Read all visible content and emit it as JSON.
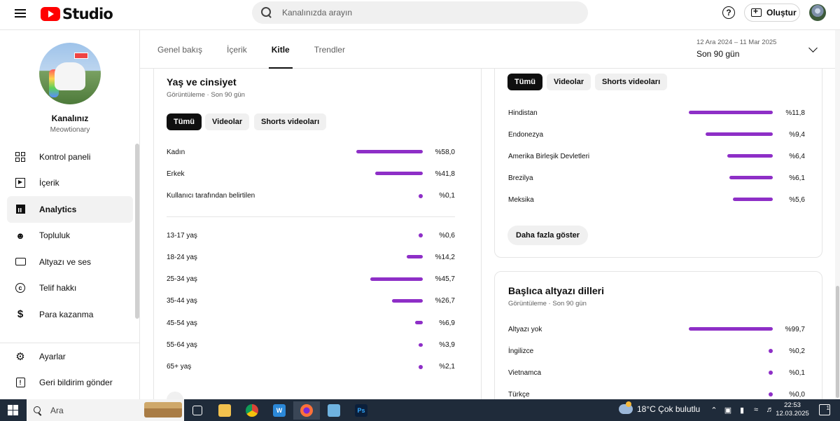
{
  "topbar": {
    "logo_text": "Studio",
    "search_placeholder": "Kanalınızda arayın",
    "create_label": "Oluştur"
  },
  "sidebar": {
    "channel_name": "Kanalınız",
    "channel_handle": "Meowtionary",
    "items": [
      {
        "label": "Kontrol paneli",
        "icon": "dashboard-icon"
      },
      {
        "label": "İçerik",
        "icon": "content-icon"
      },
      {
        "label": "Analytics",
        "icon": "analytics-icon",
        "active": true
      },
      {
        "label": "Topluluk",
        "icon": "community-icon"
      },
      {
        "label": "Altyazı ve ses",
        "icon": "subtitles-icon"
      },
      {
        "label": "Telif hakkı",
        "icon": "copyright-icon"
      },
      {
        "label": "Para kazanma",
        "icon": "dollar-icon"
      }
    ],
    "bottom_items": [
      {
        "label": "Ayarlar",
        "icon": "gear-icon"
      },
      {
        "label": "Geri bildirim gönder",
        "icon": "feedback-icon"
      }
    ]
  },
  "header": {
    "tabs": [
      "Genel bakış",
      "İçerik",
      "Kitle",
      "Trendler"
    ],
    "active_tab": "Kitle",
    "date_range": "12 Ara 2024 – 11 Mar 2025",
    "period": "Son 90 gün"
  },
  "age_gender": {
    "title": "Yaş ve cinsiyet",
    "subtitle": "Görüntüleme · Son 90 gün",
    "chips": [
      "Tümü",
      "Videolar",
      "Shorts videoları"
    ],
    "gender": [
      {
        "label": "Kadın",
        "value": "%58,0",
        "pct": 58.0
      },
      {
        "label": "Erkek",
        "value": "%41,8",
        "pct": 41.8
      },
      {
        "label": "Kullanıcı tarafından belirtilen",
        "value": "%0,1",
        "pct": 0.1
      }
    ],
    "ages": [
      {
        "label": "13-17 yaş",
        "value": "%0,6",
        "pct": 0.6
      },
      {
        "label": "18-24 yaş",
        "value": "%14,2",
        "pct": 14.2
      },
      {
        "label": "25-34 yaş",
        "value": "%45,7",
        "pct": 45.7
      },
      {
        "label": "35-44 yaş",
        "value": "%26,7",
        "pct": 26.7
      },
      {
        "label": "45-54 yaş",
        "value": "%6,9",
        "pct": 6.9
      },
      {
        "label": "55-64 yaş",
        "value": "%3,9",
        "pct": 3.9
      },
      {
        "label": "65+ yaş",
        "value": "%2,1",
        "pct": 2.1
      }
    ]
  },
  "geography": {
    "chips": [
      "Tümü",
      "Videolar",
      "Shorts videoları"
    ],
    "rows": [
      {
        "label": "Hindistan",
        "value": "%11,8",
        "pct": 11.8
      },
      {
        "label": "Endonezya",
        "value": "%9,4",
        "pct": 9.4
      },
      {
        "label": "Amerika Birleşik Devletleri",
        "value": "%6,4",
        "pct": 6.4
      },
      {
        "label": "Brezilya",
        "value": "%6,1",
        "pct": 6.1
      },
      {
        "label": "Meksika",
        "value": "%5,6",
        "pct": 5.6
      }
    ],
    "more_label": "Daha fazla göster"
  },
  "subtitles": {
    "title": "Başlıca altyazı dilleri",
    "subtitle": "Görüntüleme · Son 90 gün",
    "rows": [
      {
        "label": "Altyazı yok",
        "value": "%99,7",
        "pct": 99.7
      },
      {
        "label": "İngilizce",
        "value": "%0,2",
        "pct": 0.2
      },
      {
        "label": "Vietnamca",
        "value": "%0,1",
        "pct": 0.1
      },
      {
        "label": "Türkçe",
        "value": "%0,0",
        "pct": 0.0
      }
    ]
  },
  "taskbar": {
    "search_label": "Ara",
    "weather": "18°C  Çok bulutlu",
    "time": "22:53",
    "date": "12.03.2025",
    "notification_count": "1"
  },
  "colors": {
    "bar": "#8e2fc7",
    "brand": "#ff0000",
    "taskbar": "#1f2b3a"
  }
}
